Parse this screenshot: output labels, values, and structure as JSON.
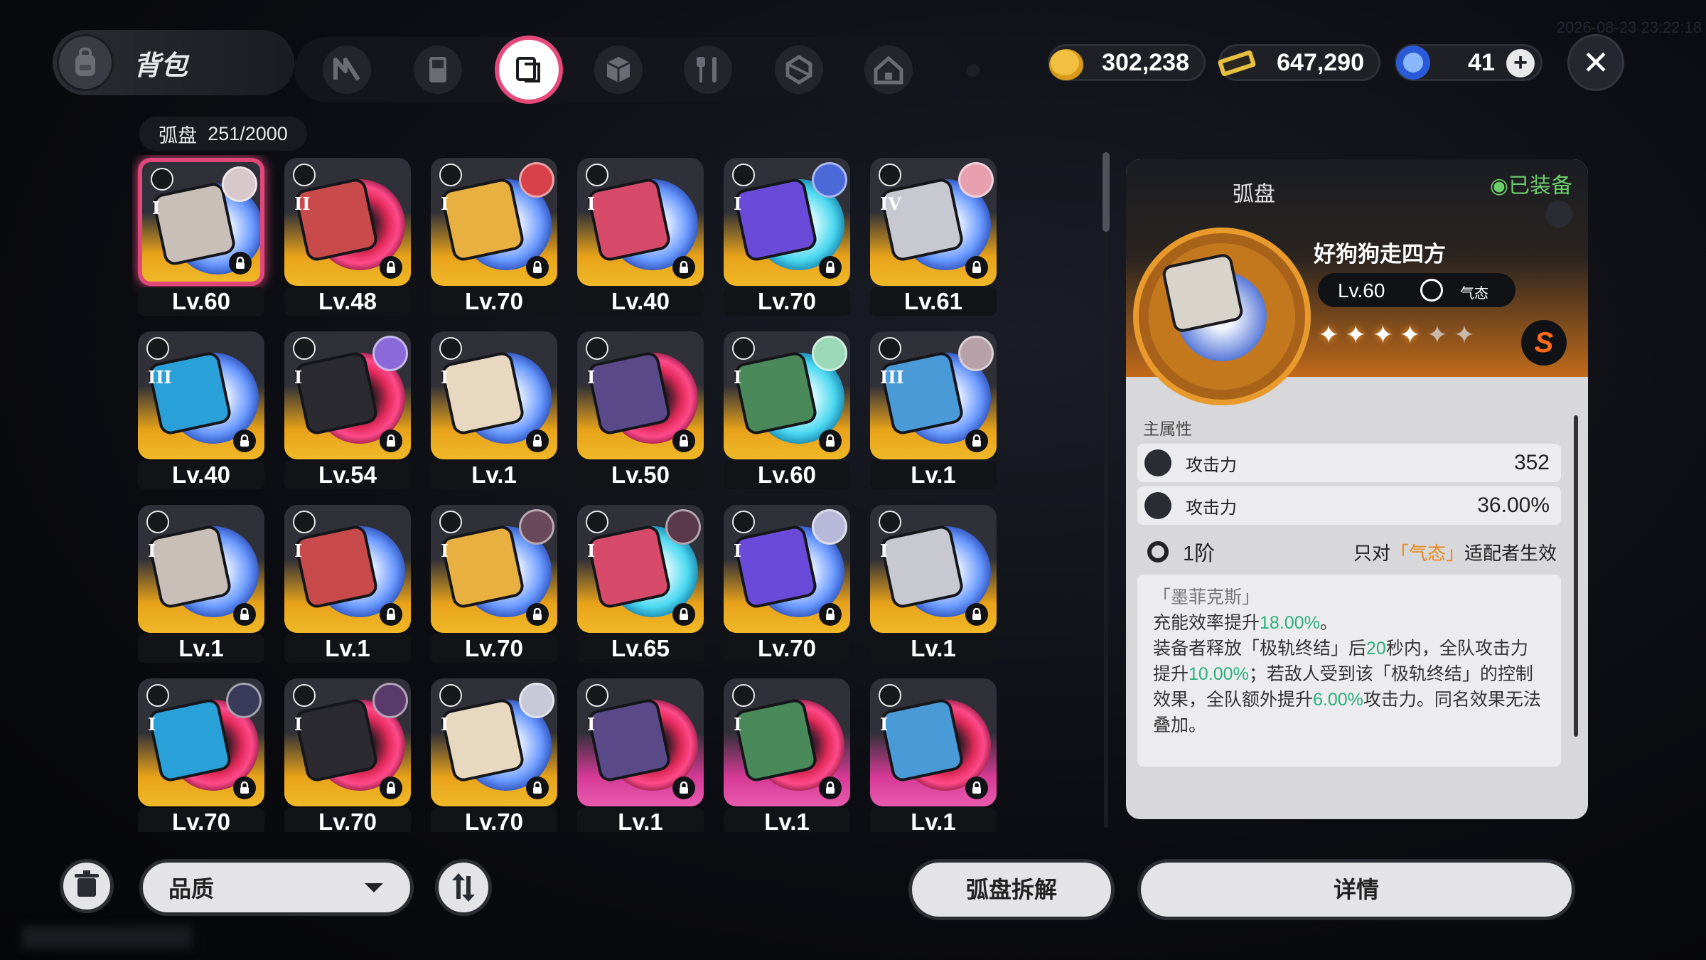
{
  "header": {
    "title": "背包",
    "watermark": "2026-08-23 23:22:18"
  },
  "tabs": [
    {
      "icon": "n-logo-icon",
      "active": false
    },
    {
      "icon": "gameboy-icon",
      "active": false
    },
    {
      "icon": "disc-drive-icon",
      "active": true
    },
    {
      "icon": "cube-icon",
      "active": false
    },
    {
      "icon": "fork-knife-icon",
      "active": false
    },
    {
      "icon": "package-icon",
      "active": false
    },
    {
      "icon": "home-icon",
      "active": false
    }
  ],
  "currency": {
    "coins": "302,238",
    "tickets": "647,290",
    "crystals": "41",
    "plus_label": "+"
  },
  "close_label": "✕",
  "inventory": {
    "label": "弧盘",
    "count": "251/2000"
  },
  "discs": [
    {
      "level": "Lv.60",
      "slot": "I",
      "color": "gold",
      "ring": "blue",
      "avatar": "#d8c8cc",
      "selected": true
    },
    {
      "level": "Lv.48",
      "slot": "II",
      "color": "gold",
      "ring": "red",
      "avatar": null
    },
    {
      "level": "Lv.70",
      "slot": "I",
      "color": "gold",
      "ring": "blue",
      "avatar": "#d8404a"
    },
    {
      "level": "Lv.40",
      "slot": "I",
      "color": "gold",
      "ring": "blue",
      "avatar": null
    },
    {
      "level": "Lv.70",
      "slot": "I",
      "color": "gold",
      "ring": "cyan",
      "avatar": "#4a6ad8"
    },
    {
      "level": "Lv.61",
      "slot": "IV",
      "color": "gold",
      "ring": "blue",
      "avatar": "#e8a0b0"
    },
    {
      "level": "Lv.40",
      "slot": "III",
      "color": "gold",
      "ring": "blue",
      "avatar": null
    },
    {
      "level": "Lv.54",
      "slot": "I",
      "color": "gold",
      "ring": "red",
      "avatar": "#8a6ad8"
    },
    {
      "level": "Lv.1",
      "slot": "I",
      "color": "gold",
      "ring": "blue",
      "avatar": null
    },
    {
      "level": "Lv.50",
      "slot": "I",
      "color": "gold",
      "ring": "red",
      "avatar": null
    },
    {
      "level": "Lv.60",
      "slot": "I",
      "color": "gold",
      "ring": "cyan",
      "avatar": "#9ad8b8"
    },
    {
      "level": "Lv.1",
      "slot": "III",
      "color": "gold",
      "ring": "blue",
      "avatar": "#b8a0a8"
    },
    {
      "level": "Lv.1",
      "slot": "I",
      "color": "gold",
      "ring": "blue",
      "avatar": null
    },
    {
      "level": "Lv.1",
      "slot": "I",
      "color": "gold",
      "ring": "blue",
      "avatar": null
    },
    {
      "level": "Lv.70",
      "slot": "I",
      "color": "gold",
      "ring": "blue",
      "avatar": "#6a4a5a"
    },
    {
      "level": "Lv.65",
      "slot": "I",
      "color": "gold",
      "ring": "cyan",
      "avatar": "#5a3a4a"
    },
    {
      "level": "Lv.70",
      "slot": "I",
      "color": "gold",
      "ring": "blue",
      "avatar": "#b8b8d8"
    },
    {
      "level": "Lv.1",
      "slot": "I",
      "color": "gold",
      "ring": "blue",
      "avatar": null
    },
    {
      "level": "Lv.70",
      "slot": "I",
      "color": "gold",
      "ring": "red",
      "avatar": "#3a3a5a"
    },
    {
      "level": "Lv.70",
      "slot": "I",
      "color": "gold",
      "ring": "red",
      "avatar": "#5a3a6a"
    },
    {
      "level": "Lv.70",
      "slot": "I",
      "color": "gold",
      "ring": "blue",
      "avatar": "#c8c8d8"
    },
    {
      "level": "Lv.1",
      "slot": "I",
      "color": "pink",
      "ring": "red",
      "avatar": null
    },
    {
      "level": "Lv.1",
      "slot": "I",
      "color": "pink",
      "ring": "red",
      "avatar": null
    },
    {
      "level": "Lv.1",
      "slot": "I",
      "color": "pink",
      "ring": "red",
      "avatar": null
    }
  ],
  "detail": {
    "type": "弧盘",
    "status": "◉已装备",
    "name": "好狗狗走四方",
    "level": "Lv.60",
    "attribute": "气态",
    "stars": "✦✦✦✦✦✦",
    "rank": "S",
    "main_attr_label": "主属性",
    "stats": [
      {
        "name": "攻击力",
        "value": "352"
      },
      {
        "name": "攻击力",
        "value": "36.00%"
      }
    ],
    "tier": "1阶",
    "tier_note_prefix": "只对",
    "tier_note_highlight": "「气态」",
    "tier_note_suffix": "适配者生效",
    "effect_title": "「墨菲克斯」",
    "effect_line1_a": "充能效率提升",
    "effect_line1_b": "18.00%",
    "effect_line1_c": "。",
    "effect_p2_a": "装备者释放「极轨终结」后",
    "effect_p2_b": "20",
    "effect_p2_c": "秒内，全队攻击力提升",
    "effect_p2_d": "10.00%",
    "effect_p2_e": "；若敌人受到该「极轨终结」的控制效果，全队额外提升",
    "effect_p2_f": "6.00%",
    "effect_p2_g": "攻击力。同名效果无法叠加。"
  },
  "bottom": {
    "quality_label": "品质",
    "dismantle_label": "弧盘拆解",
    "details_label": "详情"
  },
  "colors": {
    "accent_pink": "#e0487a",
    "gold": "#e8a21a",
    "green": "#2bb07a",
    "orange": "#e8891a"
  }
}
